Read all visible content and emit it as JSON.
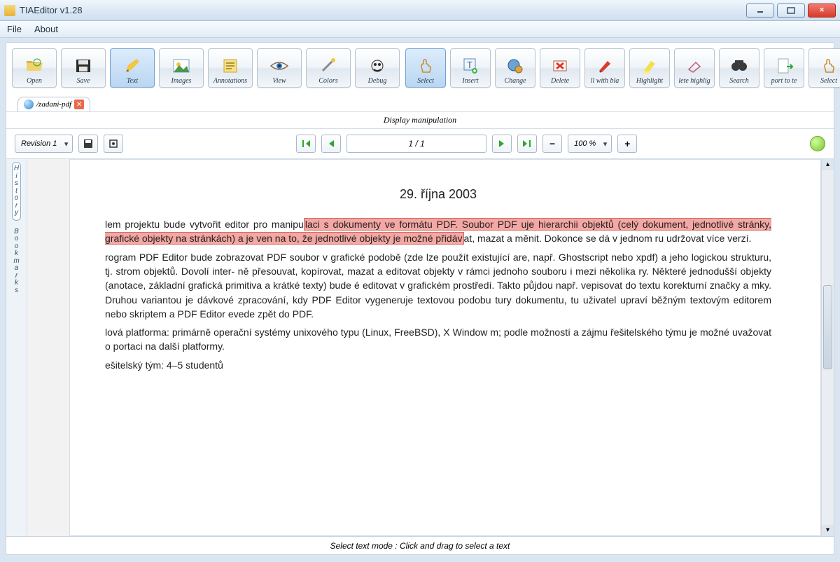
{
  "window": {
    "title": "TIAEditor v1.28"
  },
  "menu": {
    "file": "File",
    "about": "About"
  },
  "toolbar1": [
    {
      "name": "open-button",
      "label": "Open",
      "icon": "folder-open-icon"
    },
    {
      "name": "save-button",
      "label": "Save",
      "icon": "floppy-icon"
    },
    {
      "name": "text-button",
      "label": "Text",
      "icon": "pencil-icon",
      "active": true
    },
    {
      "name": "images-button",
      "label": "Images",
      "icon": "picture-icon"
    },
    {
      "name": "annotations-button",
      "label": "Annotations",
      "icon": "note-icon"
    },
    {
      "name": "view-button",
      "label": "View",
      "icon": "eye-icon"
    },
    {
      "name": "colors-button",
      "label": "Colors",
      "icon": "wand-icon"
    },
    {
      "name": "debug-button",
      "label": "Debug",
      "icon": "bug-icon"
    }
  ],
  "toolbar2": [
    {
      "name": "select-button",
      "label": "Select",
      "icon": "hand-icon",
      "active": true
    },
    {
      "name": "insert-button",
      "label": "Insert",
      "icon": "text-insert-icon"
    },
    {
      "name": "change-button",
      "label": "Change",
      "icon": "gear-globe-icon"
    },
    {
      "name": "delete-button",
      "label": "Delete",
      "icon": "delete-x-icon"
    },
    {
      "name": "fill-black-button",
      "label": "ll with bla",
      "icon": "pen-red-icon"
    },
    {
      "name": "highlight-button",
      "label": "Highlight",
      "icon": "highlighter-icon"
    },
    {
      "name": "del-highlight-button",
      "label": "lete highlig",
      "icon": "eraser-icon"
    },
    {
      "name": "search-button",
      "label": "Search",
      "icon": "binoculars-icon"
    },
    {
      "name": "export-text-button",
      "label": "port to te",
      "icon": "page-export-icon"
    },
    {
      "name": "select2-button",
      "label": "Select",
      "icon": "hand-icon"
    }
  ],
  "tab": {
    "name": "/zadani-pdf"
  },
  "section_heading": "Display  manipulation",
  "nav": {
    "revision_label": "Revision 1",
    "page_field": "1 / 1",
    "zoom_label": "100 %",
    "minus": "−",
    "plus": "+"
  },
  "side_tabs": {
    "history": "History",
    "bookmarks": "Bookmarks"
  },
  "document": {
    "date": "29. října 2003",
    "p1_pre": "lem projektu bude vytvořit editor pro manipu",
    "p1_hl": "laci s dokumenty ve formátu PDF. Soubor PDF uje hierarchii objektů (celý dokument, jednotlivé stránky, grafické objekty na stránkách) a je ven na to, že jednotlivé objekty je možné přidáv",
    "p1_post": "at, mazat a měnit. Dokonce se dá v jednom ru udržovat více verzí.",
    "p2": "rogram PDF Editor bude zobrazovat PDF soubor v grafické podobě (zde lze použít existující are, např. Ghostscript nebo xpdf) a jeho logickou strukturu, tj. strom objektů. Dovolí inter- ně přesouvat, kopírovat, mazat a editovat objekty v rámci jednoho souboru i mezi několika ry. Některé jednodušší objekty (anotace, základní grafická primitiva a krátké texty) bude é editovat v grafickém prostředí. Takto půjdou např. vepisovat do textu korekturní značky a mky. Druhou variantou je dávkové zpracování, kdy PDF Editor vygeneruje textovou podobu tury dokumentu, tu uživatel upraví běžným textovým editorem nebo skriptem a PDF Editor evede zpět do PDF.",
    "p3": "lová platforma: primárně operační systémy unixového typu (Linux, FreeBSD), X Window m; podle možností a zájmu řešitelského týmu je možné uvažovat o portaci na další platformy.",
    "p4": "ešitelský tým: 4–5 studentů"
  },
  "status": "Select text mode : Click and drag to select a text"
}
